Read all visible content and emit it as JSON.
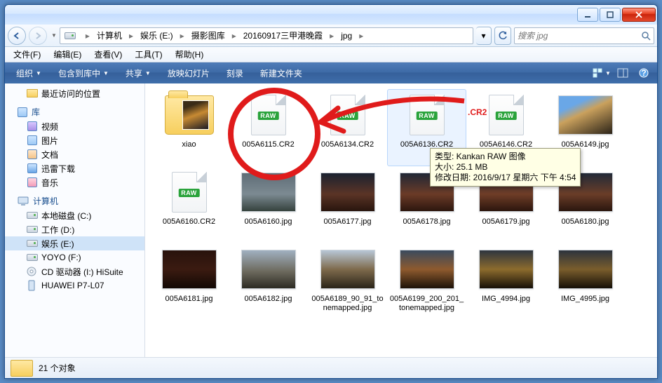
{
  "titlebar": {},
  "nav": {
    "breadcrumb": [
      "计算机",
      "娱乐 (E:)",
      "摄影图库",
      "20160917三甲港晚霞",
      "jpg"
    ],
    "search_placeholder": "搜索 jpg"
  },
  "menu": {
    "items": [
      "文件(F)",
      "编辑(E)",
      "查看(V)",
      "工具(T)",
      "帮助(H)"
    ]
  },
  "toolbar": {
    "organize": "组织",
    "include": "包含到库中",
    "share": "共享",
    "slideshow": "放映幻灯片",
    "burn": "刻录",
    "newfolder": "新建文件夹"
  },
  "tree": {
    "recent": "最近访问的位置",
    "libraries": "库",
    "video": "视频",
    "pictures": "图片",
    "documents": "文档",
    "thunder": "迅雷下载",
    "music": "音乐",
    "computer": "计算机",
    "drive_c": "本地磁盘 (C:)",
    "drive_d": "工作 (D:)",
    "drive_e": "娱乐 (E:)",
    "drive_f": "YOYO (F:)",
    "drive_cd": "CD 驱动器 (I:) HiSuite",
    "phone": "HUAWEI P7-L07"
  },
  "files": [
    {
      "name": "xiao",
      "type": "folder"
    },
    {
      "name": "005A6115.CR2",
      "type": "raw"
    },
    {
      "name": "005A6134.CR2",
      "type": "raw"
    },
    {
      "name": "005A6136.CR2",
      "type": "raw",
      "hover": true
    },
    {
      "name": "005A6146.CR2",
      "type": "raw"
    },
    {
      "name": "005A6149.jpg",
      "type": "img",
      "bg": "linear-gradient(155deg,#6aa7e7 25%,#caa15d 45%,#2b2318)"
    },
    {
      "name": "005A6160.CR2",
      "type": "raw"
    },
    {
      "name": "005A6160.jpg",
      "type": "img",
      "bg": "linear-gradient(#5e6d76,#7c8a92 55%,#35423d)"
    },
    {
      "name": "005A6177.jpg",
      "type": "img",
      "bg": "linear-gradient(#1b2230,#5b3426 55%,#28150e)"
    },
    {
      "name": "005A6178.jpg",
      "type": "img",
      "bg": "linear-gradient(#202736,#6b3b27 55%,#2c160e)"
    },
    {
      "name": "005A6179.jpg",
      "type": "img",
      "bg": "linear-gradient(#1e2432,#6f3d27 55%,#2b150d)"
    },
    {
      "name": "005A6180.jpg",
      "type": "img",
      "bg": "linear-gradient(#222a38,#6a3d28 55%,#2a160e)"
    },
    {
      "name": "005A6181.jpg",
      "type": "img",
      "bg": "linear-gradient(#28120c,#3b1b11 50%,#120804)"
    },
    {
      "name": "005A6182.jpg",
      "type": "img",
      "bg": "linear-gradient(#a0b0c0,#6d6a5e 55%,#2c2a22)"
    },
    {
      "name": "005A6189_90_91_tonemapped.jpg",
      "type": "img",
      "bg": "linear-gradient(#b7c6d6,#7e6a4c 50%,#2a2418)"
    },
    {
      "name": "005A6199_200_201_tonemapped.jpg",
      "type": "img",
      "bg": "linear-gradient(#3a4a5e,#8e5a2e 50%,#1d1208)"
    },
    {
      "name": "IMG_4994.jpg",
      "type": "img",
      "bg": "linear-gradient(#2e353f,#8c6b2d 50%,#171008)"
    },
    {
      "name": "IMG_4995.jpg",
      "type": "img",
      "bg": "linear-gradient(#2c333d,#7a5d2c 50%,#150f07)"
    }
  ],
  "tooltip": {
    "line1": "类型: Kankan RAW 图像",
    "line2": "大小: 25.1 MB",
    "line3": "修改日期: 2016/9/17 星期六 下午 4:54"
  },
  "status": {
    "text": "21 个对象"
  },
  "annotation": {
    "text": ".CR2"
  }
}
